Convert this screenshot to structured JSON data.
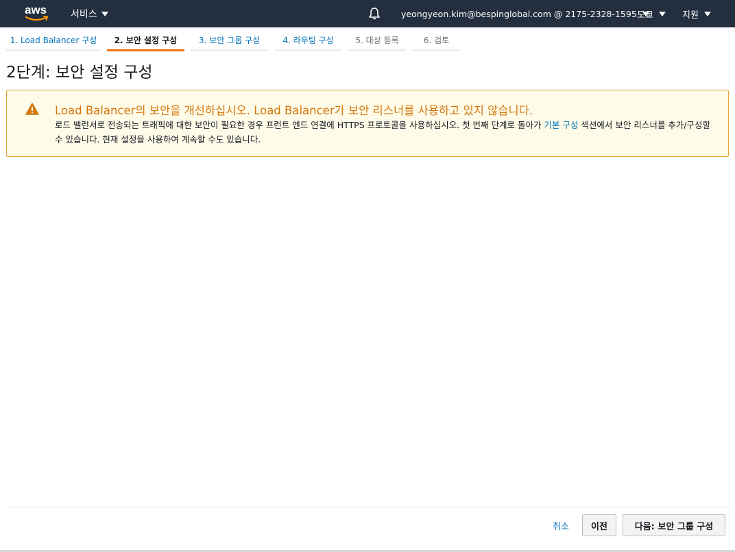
{
  "topbar": {
    "logo_text": "aws",
    "services_label": "서비스",
    "account_label": "yeongyeon.kim@bespinglobal.com @ 2175-2328-1595",
    "region_label": "도쿄",
    "support_label": "지원",
    "icons": [
      "aws-logo",
      "caret-down-icon",
      "bell-icon"
    ],
    "background_color": "#232f3e"
  },
  "steps": [
    {
      "label": "1. Load Balancer 구성",
      "state": "link"
    },
    {
      "label": "2. 보안 설정 구성",
      "state": "active"
    },
    {
      "label": "3. 보안 그룹 구성",
      "state": "link"
    },
    {
      "label": "4. 라우팅 구성",
      "state": "link"
    },
    {
      "label": "5. 대상 등록",
      "state": "disabled"
    },
    {
      "label": "6. 검토",
      "state": "disabled"
    }
  ],
  "page_title": "2단계: 보안 설정 구성",
  "alert": {
    "type": "warning",
    "icon": "warning-triangle-icon",
    "title": "Load Balancer의 보안을 개선하십시오. Load Balancer가 보안 리스너를 사용하고 있지 않습니다.",
    "body_before_link": "로드 밸런서로 전송되는 트래픽에 대한 보안이 필요한 경우 프런트 엔드 연결에 HTTPS 프로토콜을 사용하십시오. 첫 번째 단계로 돌아가 ",
    "body_link": "기본 구성",
    "body_after_link": " 섹션에서 보안 리스너를 추가/구성할 수 있습니다. 현재 설정을 사용하여 계속할 수도 있습니다.",
    "title_color": "#d4770b",
    "border_color": "#e7a53a"
  },
  "footer": {
    "cancel_label": "취소",
    "previous_label": "이전",
    "next_label": "다음: 보안 그룹 구성"
  },
  "colors": {
    "accent": "#ec7211",
    "link": "#0073bb"
  }
}
